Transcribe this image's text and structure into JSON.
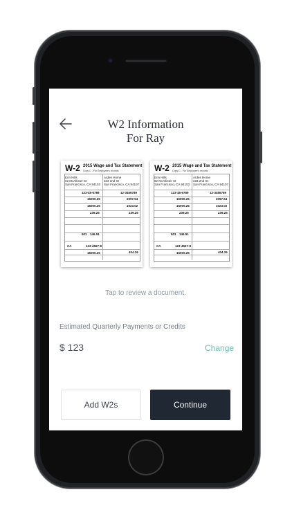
{
  "screen": {
    "title_line1": "W2 Information",
    "title_line2": "For Ray",
    "hint": "Tap to review a document.",
    "estimate_label": "Estimated Quarterly Payments or Credits",
    "amount": "$ 123",
    "change_label": "Change",
    "add_button": "Add W2s",
    "continue_button": "Continue"
  },
  "documents": [
    {
      "form": "W-2",
      "heading": "2015 Wage and Tax Statement",
      "subheading": "Copy C - For Employee's records",
      "employee_block": "Erin Hills\n92 McAllister St\nSan Francisco, CA 94103",
      "employer_block": "Arden Home\n333 2nd St\nSan Francisco, CA 94107",
      "ssn": "123-45-6789",
      "ein": "12-3456789",
      "wages": "16000.25",
      "fed_tax": "2097.54",
      "ss_wages": "16000.25",
      "ss_tax": "1023.02",
      "medicare_wages": "239.25",
      "medicare_tax": "239.25",
      "box12": "501",
      "box12_amount": "146.51",
      "state": "CA",
      "state_id": "123-4567-8",
      "state_wages": "16000.25",
      "local_tax": "404.26"
    },
    {
      "form": "W-2",
      "heading": "2015 Wage and Tax Statement",
      "subheading": "Copy C - For Employee's records",
      "employee_block": "Erin Hills\n92 McAllister St\nSan Francisco, CA 94103",
      "employer_block": "Ardes Home\n333 2nd St\nSan Francisco, CA 94107",
      "ssn": "123-45-6789",
      "ein": "12-3456789",
      "wages": "16000.25",
      "fed_tax": "2097.54",
      "ss_wages": "16000.25",
      "ss_tax": "1023.02",
      "medicare_wages": "239.25",
      "medicare_tax": "239.25",
      "box12": "501",
      "box12_amount": "146.51",
      "state": "CA",
      "state_id": "123-4567-8",
      "state_wages": "16000.25",
      "local_tax": "404.26"
    }
  ],
  "colors": {
    "accent": "#65c3b5",
    "dark_button": "#1f2833",
    "phone_body": "#202124"
  }
}
